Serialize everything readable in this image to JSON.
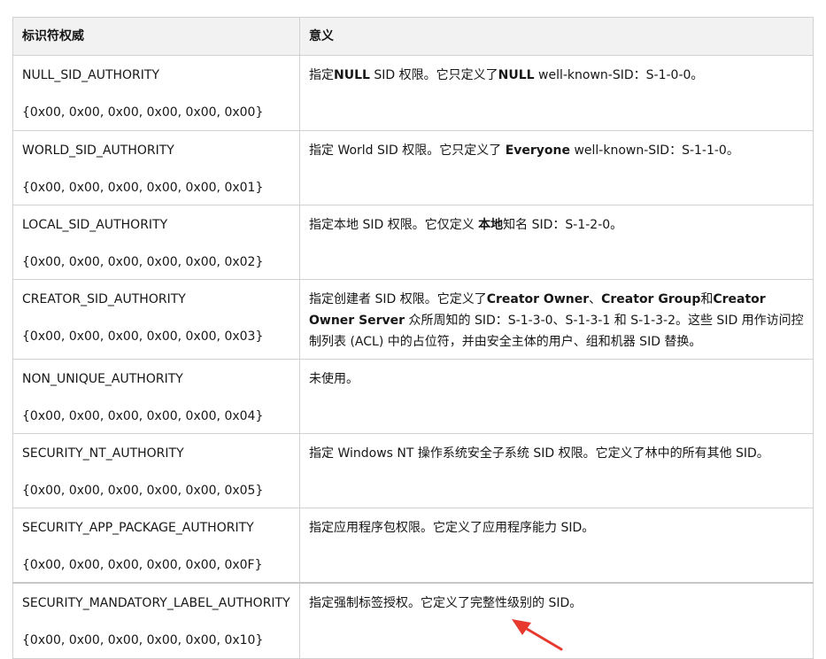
{
  "headers": {
    "identifier": "标识符权威",
    "meaning": "意义"
  },
  "rows": [
    {
      "name": "NULL_SID_AUTHORITY",
      "value": "{0x00, 0x00, 0x00, 0x00, 0x00, 0x00}",
      "desc": [
        {
          "t": "指定"
        },
        {
          "t": "NULL",
          "b": true
        },
        {
          "t": " SID 权限。它只定义了"
        },
        {
          "t": "NULL",
          "b": true
        },
        {
          "t": " well-known-SID：S-1-0-0。"
        }
      ]
    },
    {
      "name": "WORLD_SID_AUTHORITY",
      "value": "{0x00, 0x00, 0x00, 0x00, 0x00, 0x01}",
      "desc": [
        {
          "t": "指定 World SID 权限。它只定义了 "
        },
        {
          "t": "Everyone",
          "b": true
        },
        {
          "t": " well-known-SID：S-1-1-0。"
        }
      ]
    },
    {
      "name": "LOCAL_SID_AUTHORITY",
      "value": "{0x00, 0x00, 0x00, 0x00, 0x00, 0x02}",
      "desc": [
        {
          "t": "指定本地 SID 权限。它仅定义 "
        },
        {
          "t": "本地",
          "b": true
        },
        {
          "t": "知名 SID：S-1-2-0。"
        }
      ]
    },
    {
      "name": "CREATOR_SID_AUTHORITY",
      "value": "{0x00, 0x00, 0x00, 0x00, 0x00, 0x03}",
      "desc": [
        {
          "t": "指定创建者 SID 权限。它定义了"
        },
        {
          "t": "Creator Owner",
          "b": true
        },
        {
          "t": "、"
        },
        {
          "t": "Creator Group",
          "b": true
        },
        {
          "t": "和"
        },
        {
          "t": "Creator Owner Server",
          "b": true
        },
        {
          "t": " 众所周知的 SID：S-1-3-0、S-1-3-1 和 S-1-3-2。这些 SID 用作访问控制列表 (ACL) 中的占位符，并由安全主体的用户、组和机器 SID 替换。"
        }
      ]
    },
    {
      "name": "NON_UNIQUE_AUTHORITY",
      "value": "{0x00, 0x00, 0x00, 0x00, 0x00, 0x04}",
      "desc": [
        {
          "t": "未使用。"
        }
      ]
    },
    {
      "name": "SECURITY_NT_AUTHORITY",
      "value": "{0x00, 0x00, 0x00, 0x00, 0x00, 0x05}",
      "desc": [
        {
          "t": "指定 Windows NT 操作系统安全子系统 SID 权限。它定义了林中的所有其他 SID。"
        }
      ]
    },
    {
      "name": "SECURITY_APP_PACKAGE_AUTHORITY",
      "value": "{0x00, 0x00, 0x00, 0x00, 0x00, 0x0F}",
      "desc": [
        {
          "t": "指定应用程序包权限。它定义了应用程序能力 SID。"
        }
      ]
    },
    {
      "name": "SECURITY_MANDATORY_LABEL_AUTHORITY",
      "value": "{0x00, 0x00, 0x00, 0x00, 0x00, 0x10}",
      "desc": [
        {
          "t": "指定强制标签授权。它定义了完整性级别的 SID。"
        }
      ]
    }
  ],
  "annotation": {
    "color": "#e8392f",
    "icon": "red-arrow-icon"
  }
}
